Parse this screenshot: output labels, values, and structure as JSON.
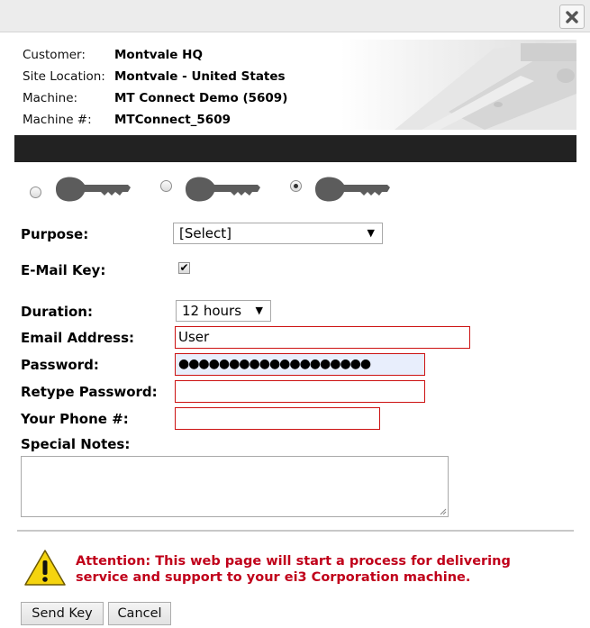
{
  "info": {
    "customer_label": "Customer:",
    "customer_value": "Montvale HQ",
    "site_label": "Site Location:",
    "site_value": "Montvale - United States",
    "machine_label": "Machine:",
    "machine_value": "MT Connect Demo (5609)",
    "machine_num_label": "Machine #:",
    "machine_num_value": "MTConnect_5609"
  },
  "key_options": [
    {
      "icon": "key-icon",
      "selected": false
    },
    {
      "icon": "key-icon",
      "selected": false
    },
    {
      "icon": "key-icon",
      "selected": true
    }
  ],
  "form": {
    "purpose_label": "Purpose:",
    "purpose_value": "[Select]",
    "email_key_label": "E-Mail Key:",
    "email_key_checked": true,
    "duration_label": "Duration:",
    "duration_value": "12 hours",
    "email_label": "Email Address:",
    "email_value": "User",
    "password_label": "Password:",
    "password_value": "●●●●●●●●●●●●●●●●●●●",
    "retype_label": "Retype Password:",
    "retype_value": "",
    "phone_label": "Your Phone #:",
    "phone_value": "",
    "notes_label": "Special Notes:",
    "notes_value": ""
  },
  "attention": {
    "icon": "warning-icon",
    "text": "Attention: This web page will start a process for delivering service and support to your ei3 Corporation machine."
  },
  "buttons": {
    "send": "Send Key",
    "cancel": "Cancel"
  },
  "colors": {
    "error_border": "#cc1111",
    "attention_text": "#c0001a",
    "header_bar": "#222222",
    "warning_yellow": "#f5d40f"
  }
}
